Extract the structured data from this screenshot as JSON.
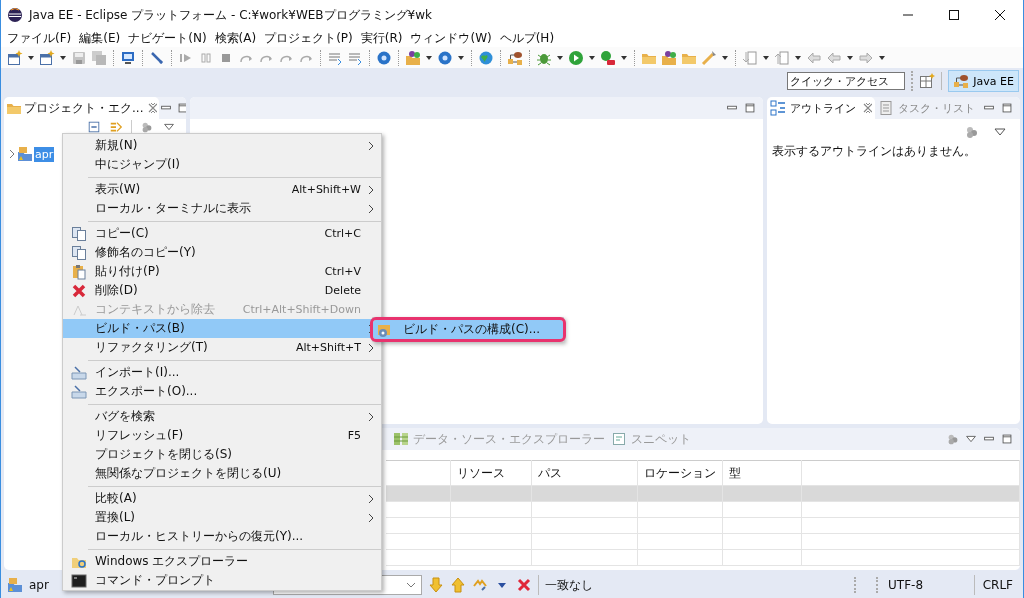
{
  "window": {
    "title": "Java EE - Eclipse プラットフォーム - C:¥work¥WEBプログラミング¥wk"
  },
  "menubar": [
    "ファイル(F)",
    "編集(E)",
    "ナビゲート(N)",
    "検索(A)",
    "プロジェクト(P)",
    "実行(R)",
    "ウィンドウ(W)",
    "ヘルプ(H)"
  ],
  "quick_access": {
    "placeholder": "クイック・アクセス"
  },
  "perspectives": [
    {
      "label": "Java EE",
      "selected": true
    }
  ],
  "project_explorer": {
    "tab": "プロジェクト・エク...",
    "tree": [
      {
        "label": "apr",
        "selected": true,
        "expanded": false
      }
    ]
  },
  "outline": {
    "tabs": [
      {
        "label": "アウトライン",
        "selected": true
      },
      {
        "label": "タスク・リスト",
        "selected": false
      }
    ],
    "message": "表示するアウトラインはありません。"
  },
  "bottom_panel": {
    "tabs": [
      {
        "label": "データ・ソース・エクスプローラー",
        "selected": false
      },
      {
        "label": "スニペット",
        "selected": false
      }
    ],
    "table": {
      "columns": [
        "リソース",
        "パス",
        "ロケーション",
        "型"
      ],
      "rows": [
        {
          "selected": true
        },
        {
          "selected": false
        },
        {
          "selected": false
        },
        {
          "selected": false
        },
        {
          "selected": false
        }
      ]
    }
  },
  "status_bar": {
    "project": "apr",
    "find_status": "一致なし",
    "encoding": "UTF-8",
    "line_delimiter": "CRLF"
  },
  "context_menu": {
    "items": [
      {
        "kind": "item",
        "label": "新規(N)",
        "submenu": true,
        "disabled": false,
        "selected": false
      },
      {
        "kind": "item",
        "label": "中にジャンプ(I)",
        "submenu": false,
        "disabled": false,
        "selected": false
      },
      {
        "kind": "separator"
      },
      {
        "kind": "item",
        "label": "表示(W)",
        "shortcut": "Alt+Shift+W",
        "submenu": true,
        "disabled": false,
        "selected": false
      },
      {
        "kind": "item",
        "label": "ローカル・ターミナルに表示",
        "submenu": true,
        "disabled": false,
        "selected": false
      },
      {
        "kind": "separator"
      },
      {
        "kind": "item",
        "label": "コピー(C)",
        "shortcut": "Ctrl+C",
        "submenu": false,
        "disabled": false,
        "selected": false
      },
      {
        "kind": "item",
        "label": "修飾名のコピー(Y)",
        "submenu": false,
        "disabled": false,
        "selected": false
      },
      {
        "kind": "item",
        "label": "貼り付け(P)",
        "shortcut": "Ctrl+V",
        "submenu": false,
        "disabled": false,
        "selected": false
      },
      {
        "kind": "item",
        "label": "削除(D)",
        "shortcut": "Delete",
        "submenu": false,
        "disabled": false,
        "selected": false
      },
      {
        "kind": "item",
        "label": "コンテキストから除去",
        "shortcut": "Ctrl+Alt+Shift+Down",
        "submenu": false,
        "disabled": true,
        "selected": false
      },
      {
        "kind": "item",
        "label": "ビルド・パス(B)",
        "submenu": true,
        "disabled": false,
        "selected": true
      },
      {
        "kind": "item",
        "label": "リファクタリング(T)",
        "shortcut": "Alt+Shift+T",
        "submenu": true,
        "disabled": false,
        "selected": false
      },
      {
        "kind": "separator"
      },
      {
        "kind": "item",
        "label": "インポート(I)...",
        "submenu": false,
        "disabled": false,
        "selected": false
      },
      {
        "kind": "item",
        "label": "エクスポート(O)...",
        "submenu": false,
        "disabled": false,
        "selected": false
      },
      {
        "kind": "separator"
      },
      {
        "kind": "item",
        "label": "バグを検索",
        "submenu": true,
        "disabled": false,
        "selected": false
      },
      {
        "kind": "item",
        "label": "リフレッシュ(F)",
        "shortcut": "F5",
        "submenu": false,
        "disabled": false,
        "selected": false
      },
      {
        "kind": "item",
        "label": "プロジェクトを閉じる(S)",
        "submenu": false,
        "disabled": false,
        "selected": false
      },
      {
        "kind": "item",
        "label": "無関係なプロジェクトを閉じる(U)",
        "submenu": false,
        "disabled": false,
        "selected": false
      },
      {
        "kind": "separator"
      },
      {
        "kind": "item",
        "label": "比較(A)",
        "submenu": true,
        "disabled": false,
        "selected": false
      },
      {
        "kind": "item",
        "label": "置換(L)",
        "submenu": true,
        "disabled": false,
        "selected": false
      },
      {
        "kind": "item",
        "label": "ローカル・ヒストリーからの復元(Y)...",
        "submenu": false,
        "disabled": false,
        "selected": false
      },
      {
        "kind": "separator"
      },
      {
        "kind": "item",
        "label": "Windows エクスプローラー",
        "submenu": false,
        "disabled": false,
        "selected": false
      },
      {
        "kind": "item",
        "label": "コマンド・プロンプト",
        "submenu": false,
        "disabled": false,
        "selected": false
      }
    ]
  },
  "submenu": {
    "highlighted": true,
    "items": [
      {
        "label": "ビルド・パスの構成(C)...",
        "selected": true
      }
    ]
  }
}
